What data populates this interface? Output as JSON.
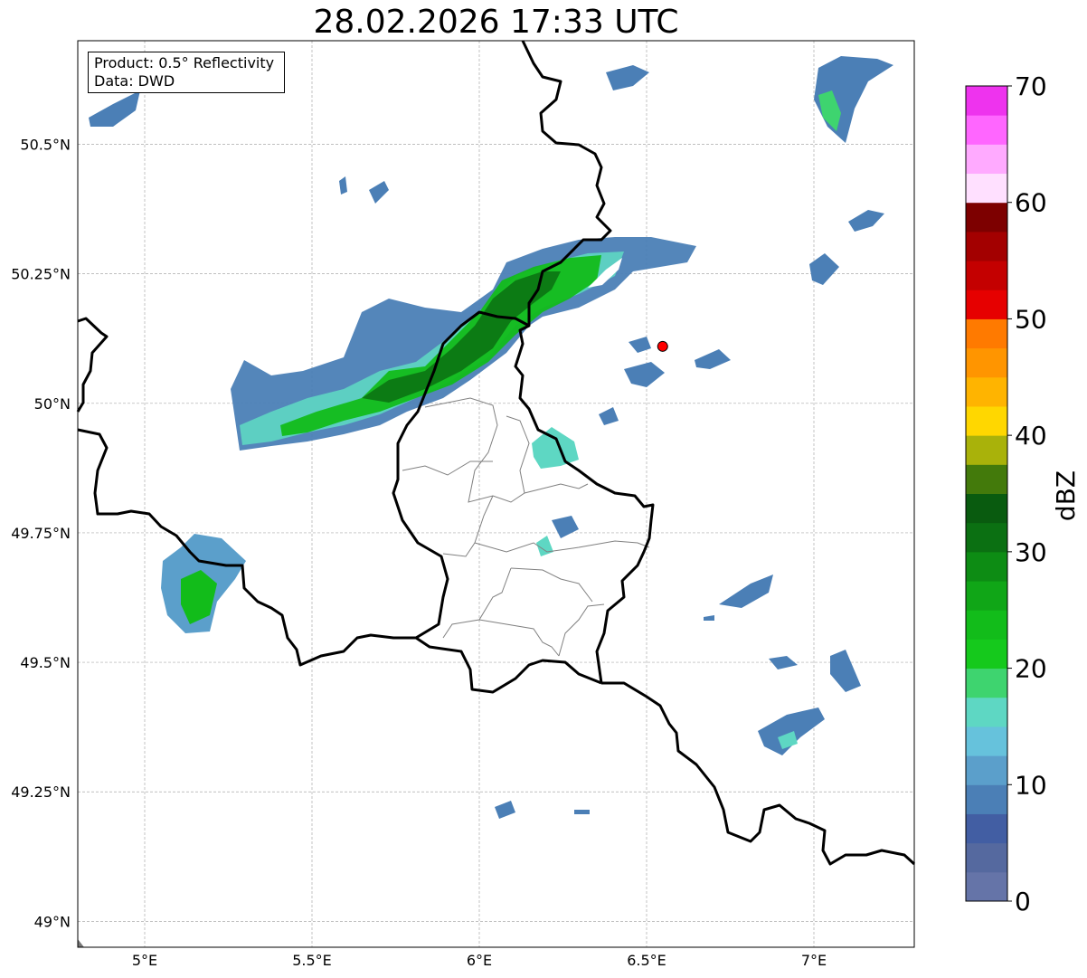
{
  "title": "28.02.2026 17:33 UTC",
  "info": {
    "product": "Product: 0.5° Reflectivity",
    "data": "Data: DWD"
  },
  "axes": {
    "lon_ticks": [
      {
        "value": 5.0,
        "label": "5°E"
      },
      {
        "value": 5.5,
        "label": "5.5°E"
      },
      {
        "value": 6.0,
        "label": "6°E"
      },
      {
        "value": 6.5,
        "label": "6.5°E"
      },
      {
        "value": 7.0,
        "label": "7°E"
      }
    ],
    "lat_ticks": [
      {
        "value": 49.0,
        "label": "49°N"
      },
      {
        "value": 49.25,
        "label": "49.25°N"
      },
      {
        "value": 49.5,
        "label": "49.5°N"
      },
      {
        "value": 49.75,
        "label": "49.75°N"
      },
      {
        "value": 50.0,
        "label": "50°N"
      },
      {
        "value": 50.25,
        "label": "50.25°N"
      },
      {
        "value": 50.5,
        "label": "50.5°N"
      }
    ],
    "lon_range": [
      4.8,
      7.3
    ],
    "lat_range": [
      48.95,
      50.7
    ],
    "grid": true
  },
  "colorbar": {
    "title": "dBZ",
    "range": [
      0,
      70
    ],
    "tick_labels": [
      "0",
      "10",
      "20",
      "30",
      "40",
      "50",
      "60",
      "70"
    ],
    "colors": [
      "#6574a8",
      "#55699f",
      "#425ea3",
      "#4b7fb6",
      "#5b9fcb",
      "#66c2dc",
      "#5ed7c3",
      "#3ed46f",
      "#15c91c",
      "#12bc1a",
      "#10a617",
      "#0d8c14",
      "#0b7012",
      "#095b0f",
      "#437a0b",
      "#a9b20a",
      "#ffd700",
      "#ffb400",
      "#ff9500",
      "#ff7a00",
      "#e60000",
      "#c40000",
      "#a30000",
      "#7d0000",
      "#ffe0ff",
      "#ffaaff",
      "#ff66ff",
      "#ee33ee"
    ]
  },
  "radar_site": {
    "lon": 6.548,
    "lat": 50.11,
    "color": "#ff0000"
  },
  "echo_colors": {
    "light": "#4b7fb6",
    "mid": "#5ed7c3",
    "strong": "#12bc1a",
    "core": "#0b7012"
  }
}
